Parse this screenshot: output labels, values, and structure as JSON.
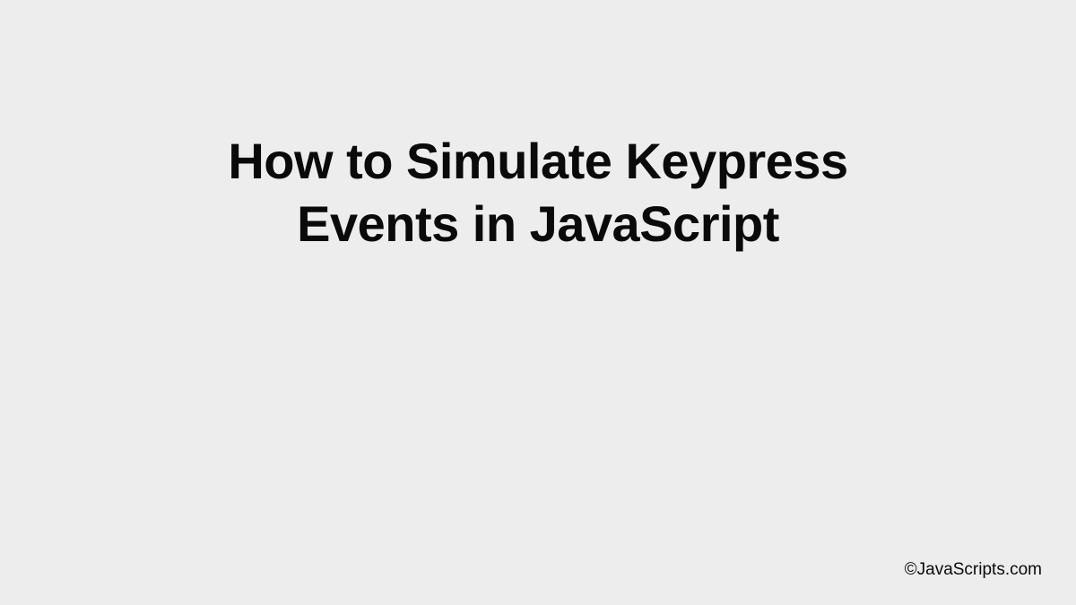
{
  "heading": {
    "line1": "How to Simulate Keypress",
    "line2": "Events in JavaScript"
  },
  "footer": {
    "attribution": "©JavaScripts.com"
  }
}
